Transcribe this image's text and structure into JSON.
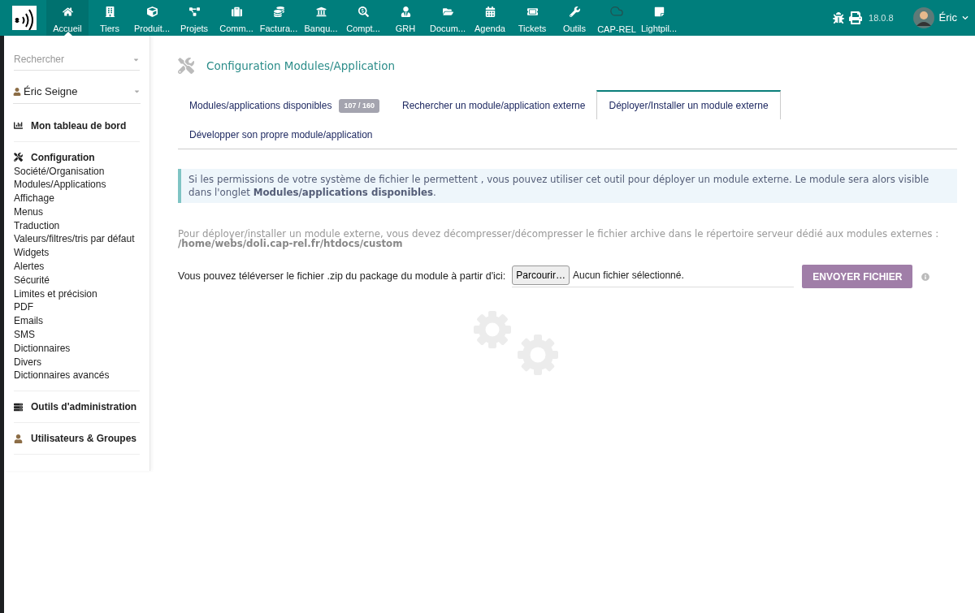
{
  "top_menu": [
    {
      "label": "Accueil",
      "selected": true
    },
    {
      "label": "Tiers",
      "selected": false
    },
    {
      "label": "Produit...",
      "selected": false
    },
    {
      "label": "Projets",
      "selected": false
    },
    {
      "label": "Comm...",
      "selected": false
    },
    {
      "label": "Factura...",
      "selected": false
    },
    {
      "label": "Banqu...",
      "selected": false
    },
    {
      "label": "Compt...",
      "selected": false
    },
    {
      "label": "GRH",
      "selected": false
    },
    {
      "label": "Docum...",
      "selected": false
    },
    {
      "label": "Agenda",
      "selected": false
    },
    {
      "label": "Tickets",
      "selected": false
    },
    {
      "label": "Outils",
      "selected": false
    },
    {
      "label": "CAP-REL",
      "selected": false
    },
    {
      "label": "Lightpil...",
      "selected": false
    }
  ],
  "version": "18.0.8",
  "user": "Éric",
  "sidebar": {
    "search": {
      "placeholder": "Rechercher"
    },
    "user_select": "Éric Seigne",
    "sections": [
      {
        "title": "Mon tableau de bord"
      },
      {
        "title": "Configuration",
        "items": [
          "Société/Organisation",
          "Modules/Applications",
          "Affichage",
          "Menus",
          "Traduction",
          "Valeurs/filtres/tris par défaut",
          "Widgets",
          "Alertes",
          "Sécurité",
          "Limites et précision",
          "PDF",
          "Emails",
          "SMS",
          "Dictionnaires",
          "Divers",
          "Dictionnaires avancés"
        ]
      },
      {
        "title": "Outils d'administration"
      },
      {
        "title": "Utilisateurs & Groupes"
      }
    ]
  },
  "page_title": "Configuration Modules/Application",
  "tabs": [
    {
      "label": "Modules/applications disponibles",
      "badge": "107 / 160",
      "selected": false
    },
    {
      "label": "Rechercher un module/application externe",
      "selected": false
    },
    {
      "label": "Déployer/Installer un module externe",
      "selected": true
    },
    {
      "label": "Développer son propre module/application",
      "selected": false
    }
  ],
  "info": "Si les permissions de votre système de fichier le permettent , vous pouvez utiliser cet outil pour déployer un module externe. Le module sera alors visible dans l'onglet **Modules/applications disponibles**.",
  "instructions": "Pour déployer/installer un module externe, vous devez décompresser/décompresser le fichier archive dans le répertoire serveur dédié aux modules externes :",
  "path": "/home/webs/doli.cap-rel.fr/htdocs/custom",
  "upload": {
    "label": "Vous pouvez téléverser le fichier .zip du package du module à partir d'ici:",
    "browse": "Parcourir…",
    "file_status": "Aucun fichier sélectionné.",
    "submit": "ENVOYER FICHIER"
  }
}
